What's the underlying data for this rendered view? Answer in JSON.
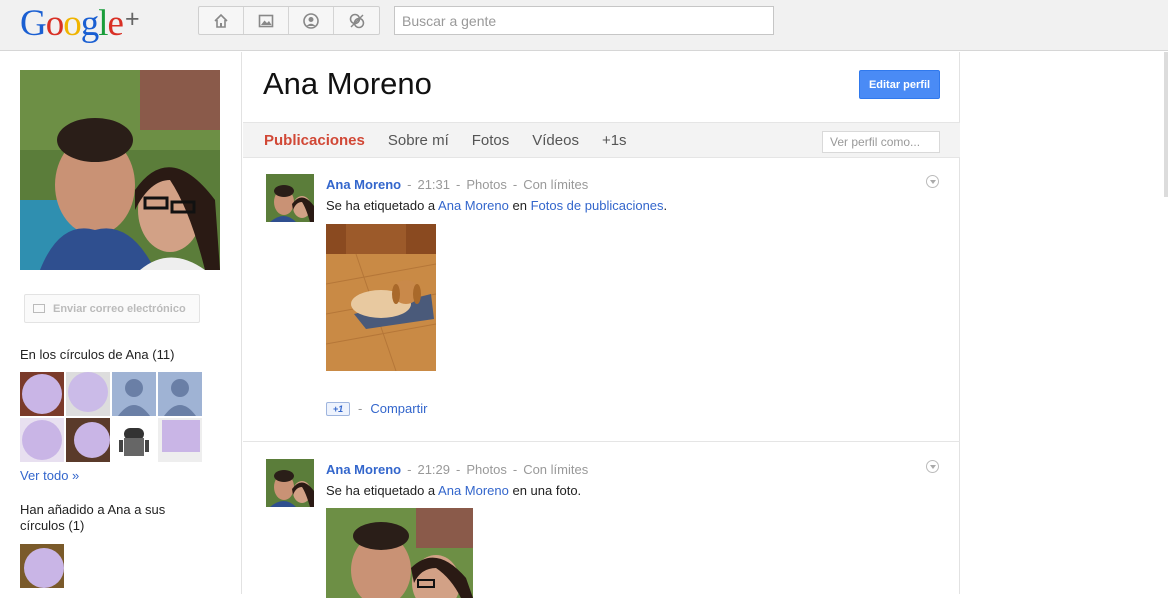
{
  "logo": {
    "letters": [
      "G",
      "o",
      "o",
      "g",
      "l",
      "e"
    ],
    "colors": [
      "#1a5fd2",
      "#d93025",
      "#f0b400",
      "#1a5fd2",
      "#199d3a",
      "#d93025"
    ],
    "plus": "+"
  },
  "nav": {
    "icons": [
      "home-icon",
      "photos-icon",
      "profile-icon",
      "circles-icon"
    ]
  },
  "search": {
    "placeholder": "Buscar a gente"
  },
  "left": {
    "email_button": "Enviar correo electrónico",
    "circles_title": "En los círculos de Ana (11)",
    "see_all": "Ver todo »",
    "added_title": "Han añadido a Ana a sus círculos (1)"
  },
  "profile": {
    "name": "Ana Moreno",
    "edit_button": "Editar perfil"
  },
  "tabs": [
    "Publicaciones",
    "Sobre mí",
    "Fotos",
    "Vídeos",
    "+1s"
  ],
  "view_as": {
    "placeholder": "Ver perfil como..."
  },
  "posts": [
    {
      "author": "Ana Moreno",
      "time": "21:31",
      "source": "Photos",
      "visibility": "Con límites",
      "sep": "-",
      "text_prefix": "Se ha etiquetado a ",
      "text_link1": "Ana Moreno",
      "text_mid": " en ",
      "text_link2": "Fotos de publicaciones",
      "text_suffix": ".",
      "plusone": "+1",
      "share": "Compartir"
    },
    {
      "author": "Ana Moreno",
      "time": "21:29",
      "source": "Photos",
      "visibility": "Con límites",
      "sep": "-",
      "text_prefix": "Se ha etiquetado a ",
      "text_link1": "Ana Moreno",
      "text_suffix": " en una foto."
    }
  ],
  "colors": {
    "accent_red": "#d14836",
    "link_blue": "#3366cc",
    "button_blue": "#4a8bf5"
  }
}
